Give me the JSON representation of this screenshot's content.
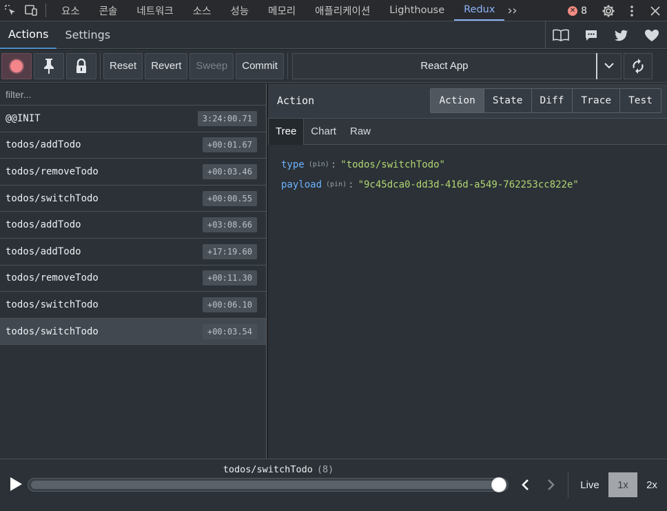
{
  "devtools": {
    "tabs": [
      {
        "label": "요소"
      },
      {
        "label": "콘솔"
      },
      {
        "label": "네트워크"
      },
      {
        "label": "소스"
      },
      {
        "label": "성능"
      },
      {
        "label": "메모리"
      },
      {
        "label": "애플리케이션"
      },
      {
        "label": "Lighthouse"
      },
      {
        "label": "Redux",
        "active": true
      }
    ],
    "error_count": "8"
  },
  "redux": {
    "subtabs": [
      {
        "label": "Actions",
        "active": true
      },
      {
        "label": "Settings"
      }
    ],
    "toolbar": {
      "reset": "Reset",
      "revert": "Revert",
      "sweep": "Sweep",
      "commit": "Commit",
      "instance": "React App"
    },
    "filter_placeholder": "filter...",
    "actions": [
      {
        "name": "@@INIT",
        "time": "3:24:00.71"
      },
      {
        "name": "todos/addTodo",
        "time": "+00:01.67"
      },
      {
        "name": "todos/removeTodo",
        "time": "+00:03.46"
      },
      {
        "name": "todos/switchTodo",
        "time": "+00:00.55"
      },
      {
        "name": "todos/addTodo",
        "time": "+03:08.66"
      },
      {
        "name": "todos/addTodo",
        "time": "+17:19.60"
      },
      {
        "name": "todos/removeTodo",
        "time": "+00:11.30"
      },
      {
        "name": "todos/switchTodo",
        "time": "+00:06.10"
      },
      {
        "name": "todos/switchTodo",
        "time": "+00:03.54",
        "selected": true
      }
    ],
    "inspector": {
      "title": "Action",
      "modes": [
        {
          "label": "Action",
          "active": true
        },
        {
          "label": "State"
        },
        {
          "label": "Diff"
        },
        {
          "label": "Trace"
        },
        {
          "label": "Test"
        }
      ],
      "views": [
        {
          "label": "Tree",
          "active": true
        },
        {
          "label": "Chart"
        },
        {
          "label": "Raw"
        }
      ],
      "tree": [
        {
          "key": "type",
          "pin": "(pin)",
          "value": "\"todos/switchTodo\""
        },
        {
          "key": "payload",
          "pin": "(pin)",
          "value": "\"9c45dca0-dd3d-416d-a549-762253cc822e\""
        }
      ]
    },
    "slider": {
      "current_action": "todos/switchTodo",
      "index_label": "(8)",
      "position": 1.0,
      "live": "Live",
      "speeds": [
        {
          "label": "1x",
          "active": true
        },
        {
          "label": "2x"
        }
      ]
    }
  },
  "colors": {
    "accent": "#8ab4f8",
    "key": "#6fb3ff",
    "value": "#b1d772",
    "record": "#f4858a"
  }
}
